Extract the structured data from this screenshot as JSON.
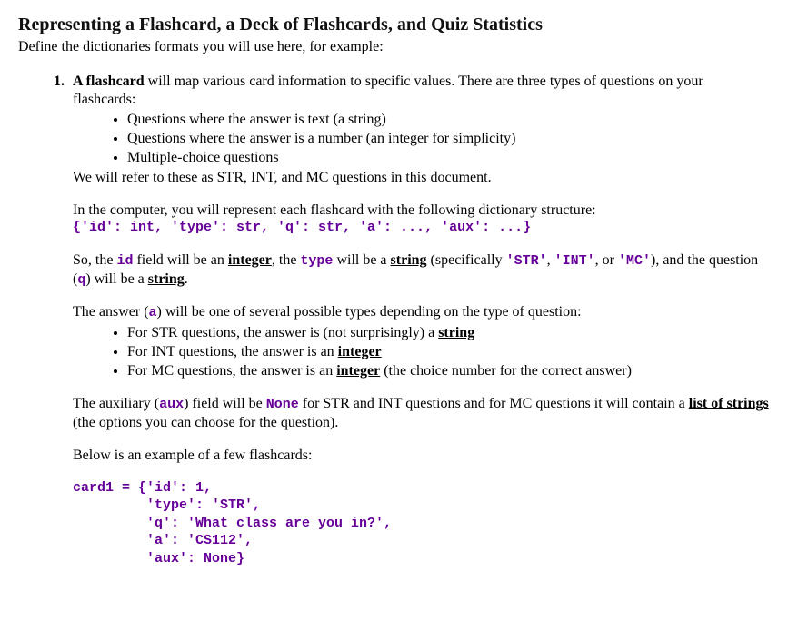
{
  "heading": "Representing a Flashcard, a Deck of Flashcards, and Quiz Statistics",
  "intro": "Define the dictionaries formats you will use here, for example:",
  "item1": {
    "lead_bold": "A flashcard",
    "lead_rest": " will map various card information to specific values. There are three types of questions on your flashcards:",
    "bullets_types": [
      "Questions where the answer is text (a string)",
      "Questions where the answer is a number (an integer for simplicity)",
      "Multiple-choice questions"
    ],
    "after_types": "We will refer to these as STR, INT, and MC questions in this document.",
    "dict_intro": "In the computer, you will represent each flashcard with the following dictionary structure:",
    "dict_code": "{'id': int, 'type': str, 'q': str, 'a': ..., 'aux': ...}",
    "id_para": {
      "t1": "So, the ",
      "id": "id",
      "t2": " field will be an ",
      "integer": "integer",
      "t3": ", the ",
      "type": "type",
      "t4": " will be a ",
      "string": "string",
      "t5": " (specifically ",
      "c1": "'STR'",
      "t6": ", ",
      "c2": "'INT'",
      "t7": ", or ",
      "c3": "'MC'",
      "t8": "), and the question (",
      "q": "q",
      "t9": ") will be a ",
      "string2": "string",
      "t10": "."
    },
    "ans_para": {
      "t1": "The answer (",
      "a": "a",
      "t2": ") will be one of several possible types depending on the type of question:"
    },
    "bullets_ans": {
      "b1": {
        "p1": "For STR questions, the answer is (not surprisingly) a ",
        "u": "string"
      },
      "b2": {
        "p1": "For INT questions, the answer is an ",
        "u": "integer"
      },
      "b3": {
        "p1": "For MC questions, the answer is an ",
        "u": "integer",
        "p2": " (the choice number for the correct answer)"
      }
    },
    "aux_para": {
      "t1": "The auxiliary (",
      "aux": "aux",
      "t2": ") field will be ",
      "none": "None",
      "t3": " for STR and INT questions and for MC questions it will contain a ",
      "list": "list of strings",
      "t4": " (the options you can choose for the question)."
    },
    "example_intro": "Below is an example of a few flashcards:",
    "codeblock": "card1 = {'id': 1,\n         'type': 'STR',\n         'q': 'What class are you in?',\n         'a': 'CS112',\n         'aux': None}"
  }
}
